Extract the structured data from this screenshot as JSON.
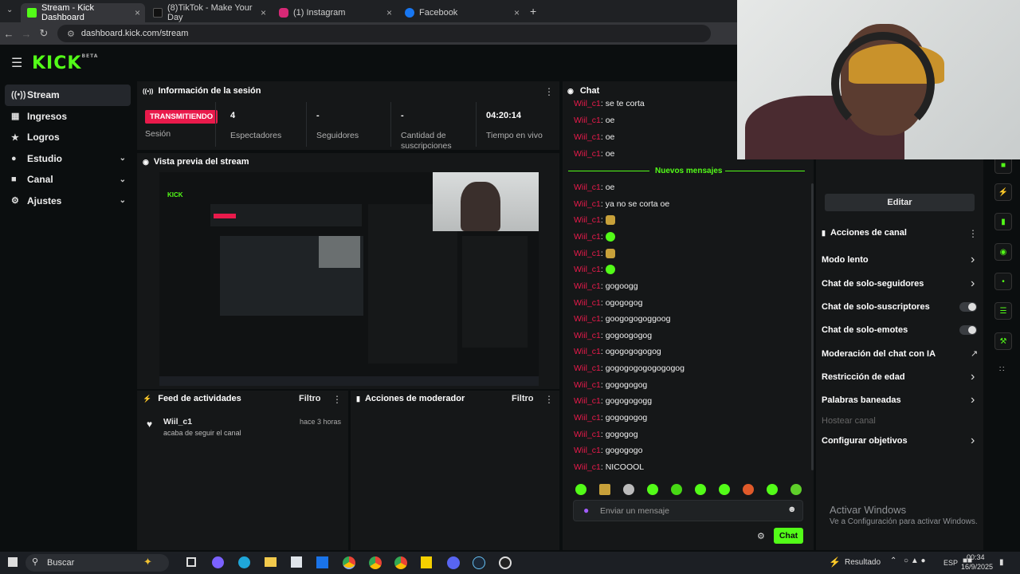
{
  "browser": {
    "tabs": [
      {
        "label": "Stream - Kick Dashboard",
        "color": "#53fc18",
        "active": true
      },
      {
        "label": "(8)TikTok - Make Your Day",
        "color": "#111111",
        "active": false
      },
      {
        "label": "(1) Instagram",
        "color": "#d62976",
        "active": false
      },
      {
        "label": "Facebook",
        "color": "#1877f2",
        "active": false
      }
    ],
    "url": "dashboard.kick.com/stream"
  },
  "kick": {
    "logo": "KICK",
    "logo_sup": "BETA",
    "sidebar": [
      {
        "label": "Stream",
        "icon": "broadcast-icon"
      },
      {
        "label": "Ingresos",
        "icon": "money-icon"
      },
      {
        "label": "Logros",
        "icon": "trophy-icon"
      },
      {
        "label": "Estudio",
        "icon": "studio-icon"
      },
      {
        "label": "Canal",
        "icon": "channel-icon"
      },
      {
        "label": "Ajustes",
        "icon": "gear-icon"
      }
    ],
    "session": {
      "title": "Información de la sesión",
      "badge": "TRANSMITIENDO",
      "badge_label": "Sesión",
      "viewers_value": "4",
      "viewers_label": "Espectadores",
      "followers_value": "-",
      "followers_label": "Seguidores",
      "subs_value": "-",
      "subs_label": "Cantidad de suscripciones",
      "time_value": "04:20:14",
      "time_label": "Tiempo en vivo"
    },
    "preview_title": "Vista previa del stream",
    "activity": {
      "title": "Feed de actividades",
      "filter": "Filtro",
      "user": "Wiil_c1",
      "when": "hace 3 horas",
      "text": "acaba de seguir el canal"
    },
    "modactions": {
      "title": "Acciones de moderador",
      "filter": "Filtro"
    },
    "chat": {
      "title": "Chat",
      "new_messages": "Nuevos mensajes",
      "messages": [
        {
          "user": "Wiil_c1",
          "text": "se te corta"
        },
        {
          "user": "Wiil_c1",
          "text": "oe"
        },
        {
          "user": "Wiil_c1",
          "text": "oe"
        },
        {
          "user": "Wiil_c1",
          "text": "oe"
        },
        {
          "user": "Wiil_c1",
          "text": "oe"
        },
        {
          "user": "Wiil_c1",
          "text": "ya no se corta oe"
        },
        {
          "user": "Wiil_c1",
          "text": ""
        },
        {
          "user": "Wiil_c1",
          "text": ""
        },
        {
          "user": "Wiil_c1",
          "text": ""
        },
        {
          "user": "Wiil_c1",
          "text": ""
        },
        {
          "user": "Wiil_c1",
          "text": "gogoogg"
        },
        {
          "user": "Wiil_c1",
          "text": "ogogogog"
        },
        {
          "user": "Wiil_c1",
          "text": "googogogoggoog"
        },
        {
          "user": "Wiil_c1",
          "text": "gogoogogog"
        },
        {
          "user": "Wiil_c1",
          "text": "ogogogogogog"
        },
        {
          "user": "Wiil_c1",
          "text": "gogogogogogogogog"
        },
        {
          "user": "Wiil_c1",
          "text": "gogogogog"
        },
        {
          "user": "Wiil_c1",
          "text": "gogogogogg"
        },
        {
          "user": "Wiil_c1",
          "text": "gogogogog"
        },
        {
          "user": "Wiil_c1",
          "text": "gogogog"
        },
        {
          "user": "Wiil_c1",
          "text": "gogogogo"
        },
        {
          "user": "Wiil_c1",
          "text": "NICOOOL"
        }
      ],
      "input_placeholder": "Enviar un mensaje",
      "send_button": "Chat"
    },
    "channel": {
      "edit_button": "Editar",
      "title": "Acciones de canal",
      "actions": [
        {
          "label": "Modo lento",
          "control": "arrow"
        },
        {
          "label": "Chat de solo-seguidores",
          "control": "arrow"
        },
        {
          "label": "Chat de solo-suscriptores",
          "control": "toggle"
        },
        {
          "label": "Chat de solo-emotes",
          "control": "toggle"
        },
        {
          "label": "Moderación del chat con IA",
          "control": "external"
        },
        {
          "label": "Restricción de edad",
          "control": "arrow"
        },
        {
          "label": "Palabras baneadas",
          "control": "arrow"
        },
        {
          "label": "Hostear canal",
          "control": "none"
        },
        {
          "label": "Configurar objetivos",
          "control": "arrow"
        }
      ]
    }
  },
  "windows": {
    "watermark_title": "Activar Windows",
    "watermark_sub": "Ve a Configuración para activar Windows.",
    "search": "Buscar",
    "weather": "Resultado",
    "lang": "ESP",
    "time": "00:34",
    "date": "16/9/2025"
  }
}
